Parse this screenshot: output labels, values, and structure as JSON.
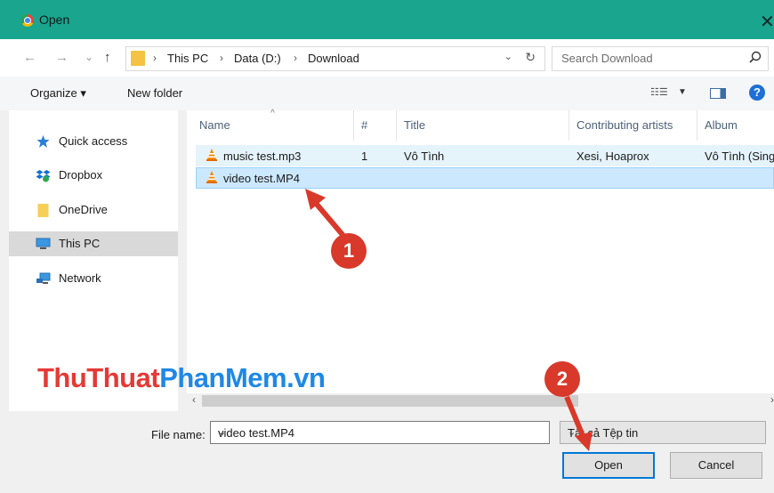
{
  "window": {
    "title": "Open",
    "close_symbol": "✕"
  },
  "nav": {
    "back": "←",
    "forward": "→",
    "recent": "⌄",
    "up": "↑"
  },
  "address": {
    "breadcrumbs": [
      "This PC",
      "Data (D:)",
      "Download"
    ],
    "separator": "›",
    "dropdown_symbol": "⌄",
    "refresh_symbol": "↻"
  },
  "search": {
    "placeholder": "Search Download"
  },
  "toolbar": {
    "organize_label": "Organize ▾",
    "new_folder_label": "New folder",
    "view_symbol": "☷☰",
    "view_dropdown": "▼",
    "help_symbol": "?"
  },
  "sidebar": {
    "items": [
      {
        "label": "Quick access",
        "icon": "star-icon"
      },
      {
        "label": "Dropbox",
        "icon": "dropbox-icon"
      },
      {
        "label": "OneDrive",
        "icon": "folder-icon"
      },
      {
        "label": "This PC",
        "icon": "computer-icon",
        "selected": true
      },
      {
        "label": "Network",
        "icon": "network-icon"
      }
    ]
  },
  "columns": [
    "Name",
    "#",
    "Title",
    "Contributing artists",
    "Album"
  ],
  "files": [
    {
      "name": "music test.mp3",
      "number": "1",
      "title": "Vô Tình",
      "artists": "Xesi, Hoaprox",
      "album": "Vô Tình (Sing"
    },
    {
      "name": "video test.MP4",
      "number": "",
      "title": "",
      "artists": "",
      "album": ""
    }
  ],
  "scroll": {
    "left": "‹",
    "right": "›"
  },
  "footer": {
    "filename_label": "File name:",
    "filename_value": "video test.MP4",
    "filetype_value": "Tất cả Tệp tin",
    "open_label": "Open",
    "cancel_label": "Cancel"
  },
  "annotations": {
    "badge1": "1",
    "badge2": "2"
  },
  "watermark": {
    "part1": "ThuThuat",
    "part2": "PhanMem.vn"
  },
  "colors": {
    "titlebar": "#1aa58f",
    "selection": "#cce8ff",
    "hover": "#e5f3fb",
    "annotation": "#d9392a",
    "focus_border": "#0078d7"
  }
}
